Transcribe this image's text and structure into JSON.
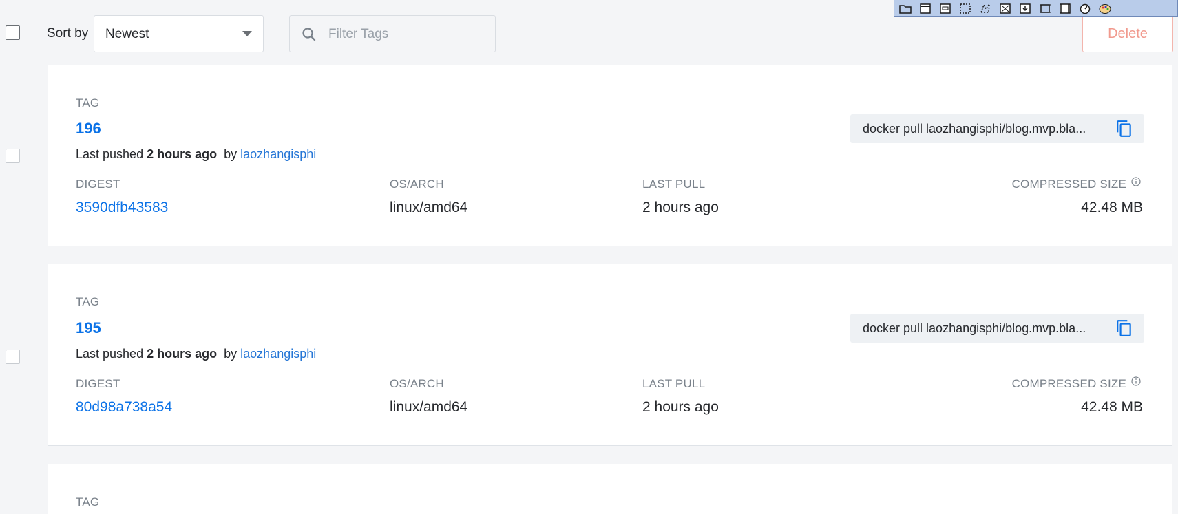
{
  "toolbar": {
    "sort_label": "Sort by",
    "sort_value": "Newest",
    "filter_placeholder": "Filter Tags",
    "delete_label": "Delete"
  },
  "colors": {
    "link": "#0b72e7",
    "delete_text": "#f19a8e",
    "page_bg": "#f4f5f7"
  },
  "columns": {
    "tag": "TAG",
    "digest": "DIGEST",
    "os_arch": "OS/ARCH",
    "last_pull": "LAST PULL",
    "compressed_size": "COMPRESSED SIZE"
  },
  "tags": [
    {
      "tag": "196",
      "pushed_prefix": "Last pushed",
      "pushed_when": "2 hours ago",
      "by": "by",
      "user": "laozhangisphi",
      "pull_command": "docker pull laozhangisphi/blog.mvp.bla...",
      "digest": "3590dfb43583",
      "os_arch": "linux/amd64",
      "last_pull": "2 hours ago",
      "size": "42.48 MB"
    },
    {
      "tag": "195",
      "pushed_prefix": "Last pushed",
      "pushed_when": "2 hours ago",
      "by": "by",
      "user": "laozhangisphi",
      "pull_command": "docker pull laozhangisphi/blog.mvp.bla...",
      "digest": "80d98a738a54",
      "os_arch": "linux/amd64",
      "last_pull": "2 hours ago",
      "size": "42.48 MB"
    }
  ],
  "partial_card": {
    "tag_label": "TAG"
  }
}
